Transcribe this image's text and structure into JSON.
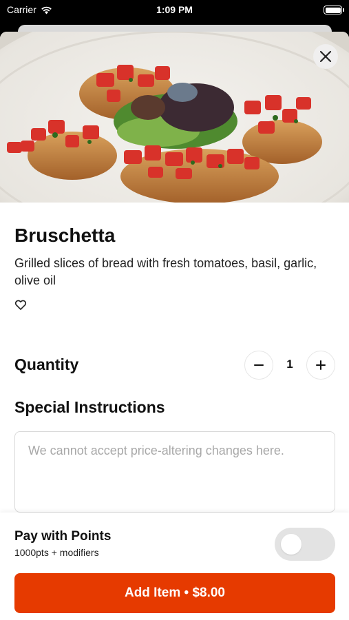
{
  "status_bar": {
    "carrier": "Carrier",
    "time": "1:09 PM",
    "wifi_icon": "wifi-icon",
    "battery_icon": "battery-icon"
  },
  "item": {
    "image_description_icon": "food-photo",
    "name": "Bruschetta",
    "description": "Grilled slices of bread with fresh tomatoes, basil, garlic, olive oil",
    "favorite_icon": "heart-outline-icon",
    "close_icon": "close-icon"
  },
  "quantity": {
    "label": "Quantity",
    "value": "1",
    "decrement_icon": "minus-icon",
    "increment_icon": "plus-icon"
  },
  "special_instructions": {
    "label": "Special Instructions",
    "placeholder": "We cannot accept price-altering changes here.",
    "value": ""
  },
  "footer": {
    "points_title": "Pay with Points",
    "points_subtitle": "1000pts + modifiers",
    "points_toggle_on": false,
    "add_button_label": "Add Item • $8.00"
  },
  "colors": {
    "accent": "#e63a00",
    "toggle_off": "#e3e3e3"
  }
}
